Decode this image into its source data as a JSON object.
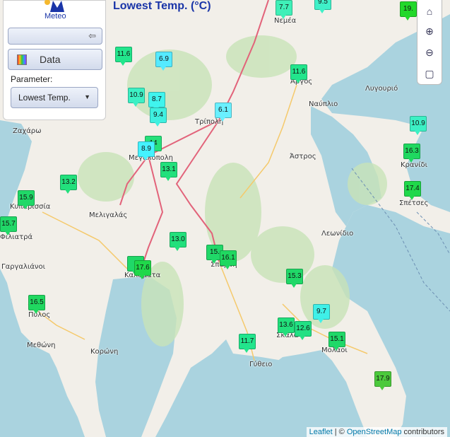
{
  "title": "Lowest Temp. (°C)",
  "panel": {
    "logo_text": "Meteo",
    "data_label": "Data",
    "parameter_label": "Parameter:",
    "parameter_value": "Lowest Temp."
  },
  "attribution": {
    "leaflet": "Leaflet",
    "sep": " | © ",
    "osm": "OpenStreetMap",
    "suffix": " contributors"
  },
  "places": [
    {
      "name": "Νεμέα"
    },
    {
      "name": "Άργος"
    },
    {
      "name": "Λυγουριό"
    },
    {
      "name": "Ναύπλιο"
    },
    {
      "name": "Τρίπολη"
    },
    {
      "name": "Ζαχάρω"
    },
    {
      "name": "Μεγαλόπολη"
    },
    {
      "name": "Άστρος"
    },
    {
      "name": "Κρανίδι"
    },
    {
      "name": "Σπέτσες"
    },
    {
      "name": "Κυπαρισσία"
    },
    {
      "name": "Μελιγαλάς"
    },
    {
      "name": "Λεωνίδιο"
    },
    {
      "name": "Φιλιατρά"
    },
    {
      "name": "Γαργαλιάνοι"
    },
    {
      "name": "Καλαμάτα"
    },
    {
      "name": "Σπάρτη"
    },
    {
      "name": "Πύλος"
    },
    {
      "name": "Σκάλα"
    },
    {
      "name": "Μολάοι"
    },
    {
      "name": "Μεθώνη"
    },
    {
      "name": "Κορώνη"
    },
    {
      "name": "Γύθειο"
    }
  ],
  "stations": [
    {
      "value": "7.7",
      "color": "#3ff0b8"
    },
    {
      "value": "9.5",
      "color": "#3ff0c8"
    },
    {
      "value": "19.",
      "color": "#22d82a"
    },
    {
      "value": "11.6",
      "color": "#22e58c"
    },
    {
      "value": "6.9",
      "color": "#55eaff"
    },
    {
      "value": "11.6",
      "color": "#22e58c"
    },
    {
      "value": "10.9",
      "color": "#3cf0c4"
    },
    {
      "value": "8.7",
      "color": "#40f4ee"
    },
    {
      "value": "9.4",
      "color": "#3ff0e0"
    },
    {
      "value": "6.1",
      "color": "#6af0ff"
    },
    {
      "value": "10.9",
      "color": "#3cf0c4"
    },
    {
      "value": "14",
      "color": "#26e07a"
    },
    {
      "value": "8.9",
      "color": "#45f2ff"
    },
    {
      "value": "16.3",
      "color": "#1fd860"
    },
    {
      "value": "13.1",
      "color": "#22e07c"
    },
    {
      "value": "13.2",
      "color": "#22e07c"
    },
    {
      "value": "15.9",
      "color": "#20d868"
    },
    {
      "value": "17.4",
      "color": "#20d84a"
    },
    {
      "value": "15.7",
      "color": "#20d868"
    },
    {
      "value": "13.0",
      "color": "#22e07c"
    },
    {
      "value": "15.",
      "color": "#20d868"
    },
    {
      "value": "16.1",
      "color": "#20d860"
    },
    {
      "value": "1",
      "color": "#20d868"
    },
    {
      "value": "17.6",
      "color": "#20d84a"
    },
    {
      "value": "15.3",
      "color": "#20d868"
    },
    {
      "value": "9.7",
      "color": "#3ff0e8"
    },
    {
      "value": "16.5",
      "color": "#20d860"
    },
    {
      "value": "13.6",
      "color": "#22e07c"
    },
    {
      "value": "12.6",
      "color": "#22e084"
    },
    {
      "value": "15.1",
      "color": "#20d868"
    },
    {
      "value": "11.7",
      "color": "#22e58c"
    },
    {
      "value": "17.9",
      "color": "#4cc93c"
    }
  ],
  "colors": {
    "sea": "#aad3df",
    "land": "#f2efe9",
    "forest": "#c8e3b8",
    "road": "#e2637a",
    "title": "#1a35a8"
  }
}
